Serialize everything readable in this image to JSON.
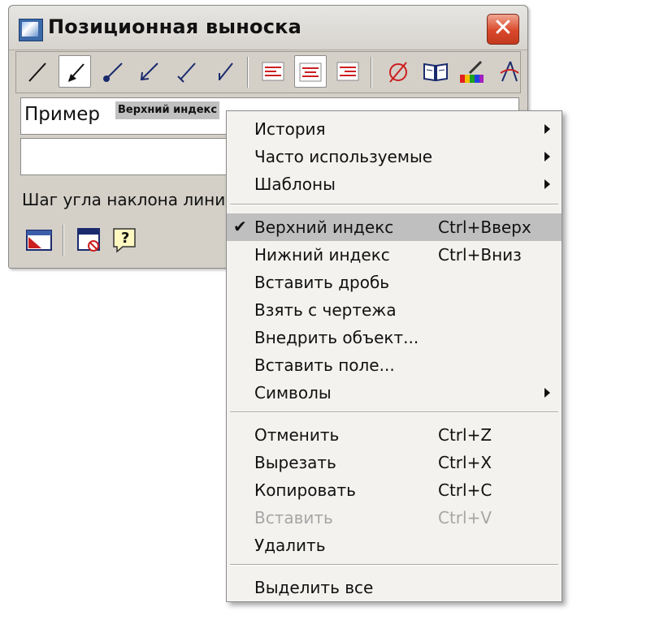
{
  "window": {
    "title": "Позиционная выноска",
    "close_symbol": "✕"
  },
  "toolbar": {
    "buttons": [
      {
        "icon": "line-no-arrow-icon"
      },
      {
        "icon": "arrow-leader-icon",
        "pressed": true
      },
      {
        "icon": "dot-leader-icon"
      },
      {
        "icon": "open-arrow-leader-icon"
      },
      {
        "icon": "tick-leader-icon"
      },
      {
        "icon": "hook-leader-icon"
      },
      {
        "icon": "align-left-icon"
      },
      {
        "icon": "align-center-icon",
        "pressed": true
      },
      {
        "icon": "align-right-icon"
      },
      {
        "icon": "diameter-symbol-icon"
      },
      {
        "icon": "library-book-icon"
      },
      {
        "icon": "color-palette-icon"
      },
      {
        "icon": "compass-icon"
      }
    ],
    "accent_red": "#cc1f1f"
  },
  "text_field": {
    "value": "Пример",
    "superscript": "Верхний индекс"
  },
  "angle_label": "Шаг угла наклона линии-",
  "bottom_buttons": [
    {
      "icon": "table-settings-icon"
    },
    {
      "icon": "gost-stamp-icon"
    },
    {
      "icon": "help-icon",
      "glyph": "?"
    }
  ],
  "context_menu": {
    "items": [
      {
        "label": "История",
        "submenu": true
      },
      {
        "label": "Часто используемые",
        "submenu": true
      },
      {
        "label": "Шаблоны",
        "submenu": true
      },
      {
        "separator": true
      },
      {
        "label": "Верхний индекс",
        "shortcut": "Ctrl+Вверх",
        "checked": true,
        "highlighted": true
      },
      {
        "label": "Нижний индекс",
        "shortcut": "Ctrl+Вниз"
      },
      {
        "label": "Вставить дробь"
      },
      {
        "label": "Взять с чертежа"
      },
      {
        "label": "Внедрить объект..."
      },
      {
        "label": "Вставить поле..."
      },
      {
        "label": "Символы",
        "submenu": true
      },
      {
        "separator": true
      },
      {
        "label": "Отменить",
        "shortcut": "Ctrl+Z"
      },
      {
        "label": "Вырезать",
        "shortcut": "Ctrl+X"
      },
      {
        "label": "Копировать",
        "shortcut": "Ctrl+C"
      },
      {
        "label": "Вставить",
        "shortcut": "Ctrl+V",
        "disabled": true
      },
      {
        "label": "Удалить"
      },
      {
        "separator": true
      },
      {
        "label": "Выделить все"
      }
    ],
    "check_glyph": "✔"
  }
}
